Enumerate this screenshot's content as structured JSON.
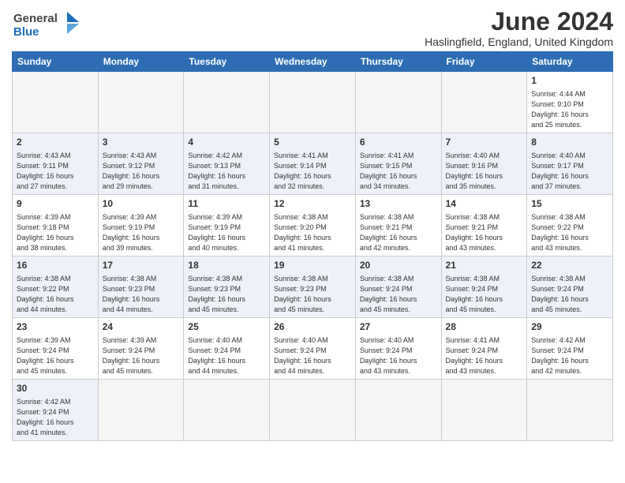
{
  "logo": {
    "text_general": "General",
    "text_blue": "Blue"
  },
  "title": "June 2024",
  "subtitle": "Haslingfield, England, United Kingdom",
  "weekdays": [
    "Sunday",
    "Monday",
    "Tuesday",
    "Wednesday",
    "Thursday",
    "Friday",
    "Saturday"
  ],
  "weeks": [
    [
      {
        "day": "",
        "info": ""
      },
      {
        "day": "",
        "info": ""
      },
      {
        "day": "",
        "info": ""
      },
      {
        "day": "",
        "info": ""
      },
      {
        "day": "",
        "info": ""
      },
      {
        "day": "",
        "info": ""
      },
      {
        "day": "1",
        "info": "Sunrise: 4:44 AM\nSunset: 9:10 PM\nDaylight: 16 hours\nand 25 minutes."
      }
    ],
    [
      {
        "day": "2",
        "info": "Sunrise: 4:43 AM\nSunset: 9:11 PM\nDaylight: 16 hours\nand 27 minutes."
      },
      {
        "day": "3",
        "info": "Sunrise: 4:43 AM\nSunset: 9:12 PM\nDaylight: 16 hours\nand 29 minutes."
      },
      {
        "day": "4",
        "info": "Sunrise: 4:42 AM\nSunset: 9:13 PM\nDaylight: 16 hours\nand 31 minutes."
      },
      {
        "day": "5",
        "info": "Sunrise: 4:41 AM\nSunset: 9:14 PM\nDaylight: 16 hours\nand 32 minutes."
      },
      {
        "day": "6",
        "info": "Sunrise: 4:41 AM\nSunset: 9:15 PM\nDaylight: 16 hours\nand 34 minutes."
      },
      {
        "day": "7",
        "info": "Sunrise: 4:40 AM\nSunset: 9:16 PM\nDaylight: 16 hours\nand 35 minutes."
      },
      {
        "day": "8",
        "info": "Sunrise: 4:40 AM\nSunset: 9:17 PM\nDaylight: 16 hours\nand 37 minutes."
      }
    ],
    [
      {
        "day": "9",
        "info": "Sunrise: 4:39 AM\nSunset: 9:18 PM\nDaylight: 16 hours\nand 38 minutes."
      },
      {
        "day": "10",
        "info": "Sunrise: 4:39 AM\nSunset: 9:19 PM\nDaylight: 16 hours\nand 39 minutes."
      },
      {
        "day": "11",
        "info": "Sunrise: 4:39 AM\nSunset: 9:19 PM\nDaylight: 16 hours\nand 40 minutes."
      },
      {
        "day": "12",
        "info": "Sunrise: 4:38 AM\nSunset: 9:20 PM\nDaylight: 16 hours\nand 41 minutes."
      },
      {
        "day": "13",
        "info": "Sunrise: 4:38 AM\nSunset: 9:21 PM\nDaylight: 16 hours\nand 42 minutes."
      },
      {
        "day": "14",
        "info": "Sunrise: 4:38 AM\nSunset: 9:21 PM\nDaylight: 16 hours\nand 43 minutes."
      },
      {
        "day": "15",
        "info": "Sunrise: 4:38 AM\nSunset: 9:22 PM\nDaylight: 16 hours\nand 43 minutes."
      }
    ],
    [
      {
        "day": "16",
        "info": "Sunrise: 4:38 AM\nSunset: 9:22 PM\nDaylight: 16 hours\nand 44 minutes."
      },
      {
        "day": "17",
        "info": "Sunrise: 4:38 AM\nSunset: 9:23 PM\nDaylight: 16 hours\nand 44 minutes."
      },
      {
        "day": "18",
        "info": "Sunrise: 4:38 AM\nSunset: 9:23 PM\nDaylight: 16 hours\nand 45 minutes."
      },
      {
        "day": "19",
        "info": "Sunrise: 4:38 AM\nSunset: 9:23 PM\nDaylight: 16 hours\nand 45 minutes."
      },
      {
        "day": "20",
        "info": "Sunrise: 4:38 AM\nSunset: 9:24 PM\nDaylight: 16 hours\nand 45 minutes."
      },
      {
        "day": "21",
        "info": "Sunrise: 4:38 AM\nSunset: 9:24 PM\nDaylight: 16 hours\nand 45 minutes."
      },
      {
        "day": "22",
        "info": "Sunrise: 4:38 AM\nSunset: 9:24 PM\nDaylight: 16 hours\nand 45 minutes."
      }
    ],
    [
      {
        "day": "23",
        "info": "Sunrise: 4:39 AM\nSunset: 9:24 PM\nDaylight: 16 hours\nand 45 minutes."
      },
      {
        "day": "24",
        "info": "Sunrise: 4:39 AM\nSunset: 9:24 PM\nDaylight: 16 hours\nand 45 minutes."
      },
      {
        "day": "25",
        "info": "Sunrise: 4:40 AM\nSunset: 9:24 PM\nDaylight: 16 hours\nand 44 minutes."
      },
      {
        "day": "26",
        "info": "Sunrise: 4:40 AM\nSunset: 9:24 PM\nDaylight: 16 hours\nand 44 minutes."
      },
      {
        "day": "27",
        "info": "Sunrise: 4:40 AM\nSunset: 9:24 PM\nDaylight: 16 hours\nand 43 minutes."
      },
      {
        "day": "28",
        "info": "Sunrise: 4:41 AM\nSunset: 9:24 PM\nDaylight: 16 hours\nand 43 minutes."
      },
      {
        "day": "29",
        "info": "Sunrise: 4:42 AM\nSunset: 9:24 PM\nDaylight: 16 hours\nand 42 minutes."
      }
    ],
    [
      {
        "day": "30",
        "info": "Sunrise: 4:42 AM\nSunset: 9:24 PM\nDaylight: 16 hours\nand 41 minutes."
      },
      {
        "day": "",
        "info": ""
      },
      {
        "day": "",
        "info": ""
      },
      {
        "day": "",
        "info": ""
      },
      {
        "day": "",
        "info": ""
      },
      {
        "day": "",
        "info": ""
      },
      {
        "day": "",
        "info": ""
      }
    ]
  ]
}
